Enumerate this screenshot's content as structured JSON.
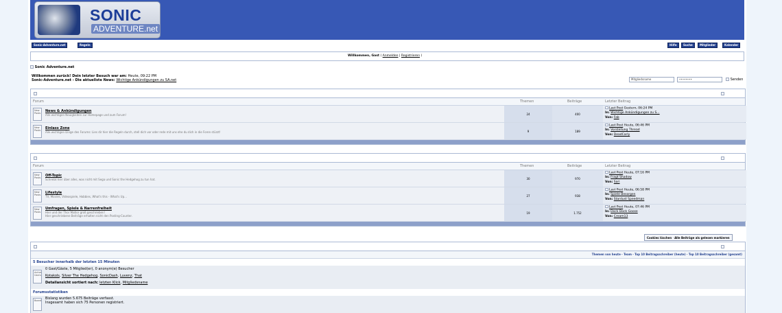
{
  "logo": {
    "line1": "SONIC",
    "line2": "ADVENTURE.net"
  },
  "nav_left": [
    "Sonic-Adventure.net",
    "Regeln"
  ],
  "nav_right": [
    "Hilfe",
    "Suche",
    "Mitglieder",
    "Kalender"
  ],
  "welcome_bar": {
    "greeting": "Willkommen, Gast",
    "sep1": "(",
    "login": "Anmelden",
    "mid": "|",
    "register": "Registrieren",
    "end": ")"
  },
  "breadcrumb": {
    "img_alt": "&#8195;",
    "title": "Sonic Adventure.net"
  },
  "intro": {
    "last_visit_label": "Willkommen zurück! Dein letzter Besuch war am:",
    "last_visit_value": "Heute, 09:22 PM",
    "news_label": "Sonic-Adventure.net - Die aktuellste News:",
    "news_link": "Wichtige Ankündigungen zu SA.net"
  },
  "login": {
    "user_placeholder": "Mitgliedsname",
    "pass_placeholder": "••••••••",
    "submit": "Senden"
  },
  "columns": {
    "forum": "Forum",
    "threads": "Themen",
    "posts": "Beiträge",
    "last": "Letzter Beitrag"
  },
  "icon_alt": "New Posts",
  "lastpost_alt": "Last Post",
  "in_label": "In:",
  "by_label": "Von:",
  "categories": [
    {
      "forums": [
        {
          "name": "News & Ankündigungen",
          "desc": "Alle wichtigen Neuigkeiten zur Homepage und zum Forum!",
          "threads": "24",
          "posts": "400",
          "date": "Gestern, 06:24 PM",
          "thread": "Wichtige Ankündigungen zu S...",
          "user": "Fab"
        },
        {
          "name": "Einlass Zone",
          "desc": "Alle wichtigen Dinge des Forums: Lies dir hier die Regeln durch, stell dich vor oder rede mit uns ehe du dich in die Foren stürzt!",
          "threads": "9",
          "posts": "189",
          "date": "Heute, 06:46 PM",
          "thread": "Vorstellung Thread",
          "user": "DeadCarly"
        }
      ]
    },
    {
      "forums": [
        {
          "name": "Off-Topic",
          "desc": "Schreibt hier über alles, was nicht mit Sega und Sonic the Hedgehog zu tun hat.",
          "threads": "30",
          "posts": "970",
          "date": "Heute, 07:16 PM",
          "thread": "Fragt Shadow",
          "user": "Sari"
        },
        {
          "name": "Lifestyle",
          "desc": "TV, Movies, Videospiele, Hobbies, What's this - What's Up...",
          "threads": "27",
          "posts": "938",
          "date": "Heute, 06:58 PM",
          "thread": "Spiele Besorgen",
          "user": "Stardust Speedman"
        },
        {
          "name": "Umfragen, Spiele & Narrenfreiheit",
          "desc": "Hier und der Thor Matlor groß geschrieben!\nHier geschriebene Beiträge erhalten nicht den Posting-Counter.",
          "threads": "19",
          "posts": "1.752",
          "date": "Heute, 07:46 PM",
          "thread": "Dock Dock Goose",
          "user": "Cream13"
        }
      ]
    }
  ],
  "board_buttons": {
    "cookies": "Cookies löschen",
    "mark_read": "Alle Beiträge als gelesen markieren"
  },
  "stats": {
    "links": "Themen von heute · Team · Top 10 Beitragsschreiber (heute) · Top 10 Beitragsschreiber (gesamt)",
    "online_title": "5 Besucher innerhalb der letzten 15 Minuten",
    "online_icon_alt": "Active Users",
    "online_counts": "0 Gast/Gäste, 5 Mitglied(er), 0 anonym(e) Besucher",
    "online_users": [
      "Kotakols",
      "Silver The Hedgehog",
      "SonicDash",
      "Luvenz",
      "That"
    ],
    "detail_label": "Detailansicht sortiert nach:",
    "detail_links": [
      "letzten Klick",
      "Mitgliedsname"
    ],
    "board_title": "Forumsstatistiken",
    "board_icon_alt": "Board",
    "board_line1": "Bislang wurden 5.675 Beiträge verfasst.",
    "board_line2": "Insgesamt haben sich 75 Personen registriert."
  },
  "colors": {
    "header_blue": "#3758b5",
    "nav_blue": "#23418f",
    "page_bg": "#eef4fb"
  }
}
